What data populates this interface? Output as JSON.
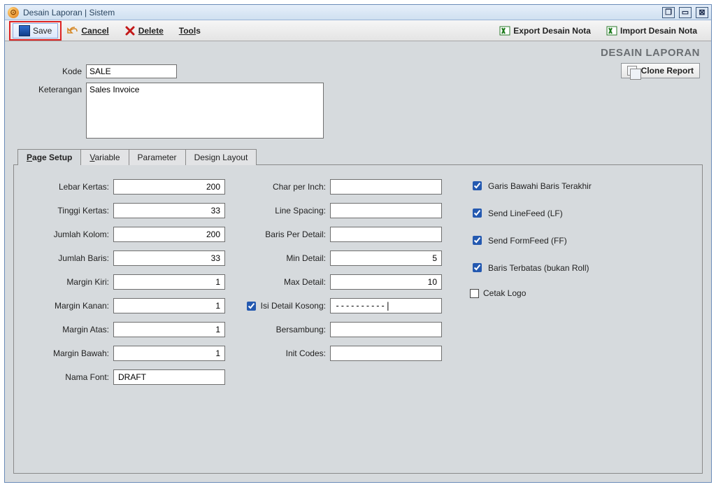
{
  "window": {
    "title": "Desain Laporan | Sistem"
  },
  "toolbar": {
    "save": "Save",
    "cancel": "Cancel",
    "delete": "Delete",
    "tools": "Tools",
    "export_nota": "Export Desain Nota",
    "import_nota": "Import Desain Nota"
  },
  "header": {
    "title": "DESAIN LAPORAN"
  },
  "form": {
    "kode_label": "Kode",
    "kode_value": "SALE",
    "ket_label": "Keterangan",
    "ket_value": "Sales Invoice",
    "clone": "Clone Report"
  },
  "tabs": {
    "page_setup": "Page Setup",
    "variable": "Variable",
    "parameter": "Parameter",
    "design_layout": "Design Layout"
  },
  "page_setup": {
    "c1_labels": {
      "lebar": "Lebar Kertas:",
      "tinggi": "Tinggi Kertas:",
      "kolom": "Jumlah Kolom:",
      "baris": "Jumlah Baris:",
      "mkiri": "Margin Kiri:",
      "mkanan": "Margin Kanan:",
      "matas": "Margin Atas:",
      "mbawah": "Margin Bawah:",
      "font": "Nama Font:"
    },
    "c1_values": {
      "lebar": "200",
      "tinggi": "33",
      "kolom": "200",
      "baris": "33",
      "mkiri": "1",
      "mkanan": "1",
      "matas": "1",
      "mbawah": "1",
      "font": "DRAFT"
    },
    "c2_labels": {
      "cpi": "Char per Inch:",
      "lspace": "Line Spacing:",
      "bpd": "Baris Per Detail:",
      "mind": "Min Detail:",
      "maxd": "Max Detail:",
      "isidet": "Isi Detail Kosong:",
      "bersambung": "Bersambung:",
      "init": "Init Codes:"
    },
    "c2_values": {
      "cpi": "",
      "lspace": "",
      "bpd": "",
      "mind": "5",
      "maxd": "10",
      "isidet": "----------|",
      "bersambung": "",
      "init": ""
    },
    "c3": {
      "garis": "Garis Bawahi Baris Terakhir",
      "lf": "Send LineFeed (LF)",
      "ff": "Send FormFeed (FF)",
      "roll": "Baris Terbatas (bukan Roll)",
      "logo": "Cetak Logo"
    }
  }
}
